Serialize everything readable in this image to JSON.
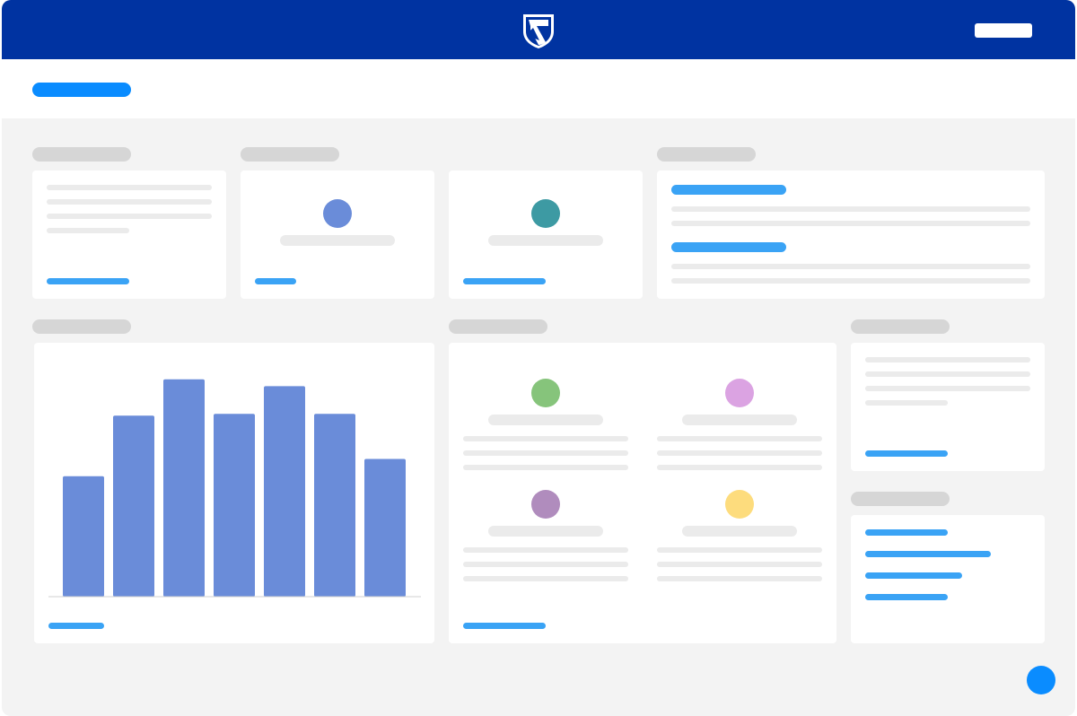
{
  "header": {
    "logo_icon": "shield-logo-icon",
    "brand_color": "#0033a1",
    "action_button": {
      "label": "",
      "color": "#ffffff"
    }
  },
  "subheader": {
    "accent": "#0a8cff"
  },
  "accent_colors": {
    "link": "#3aa3f5",
    "dot_row1_a": "#6a8cd9",
    "dot_row1_b": "#3d9aa3",
    "dot_green": "#86c47b",
    "dot_pink": "#dba3e2",
    "dot_purple": "#b08cbd",
    "dot_yellow": "#fddc7d"
  },
  "chart_data": {
    "type": "bar",
    "categories": [
      "",
      "",
      "",
      "",
      "",
      "",
      ""
    ],
    "values": [
      139,
      209,
      251,
      211,
      243,
      211,
      159
    ],
    "ylim": [
      0,
      260
    ],
    "bar_color": "#6a8cd9",
    "grid": false,
    "legend": "none"
  },
  "fab": {
    "icon": "fab-circle-icon",
    "color": "#0a8cff"
  }
}
